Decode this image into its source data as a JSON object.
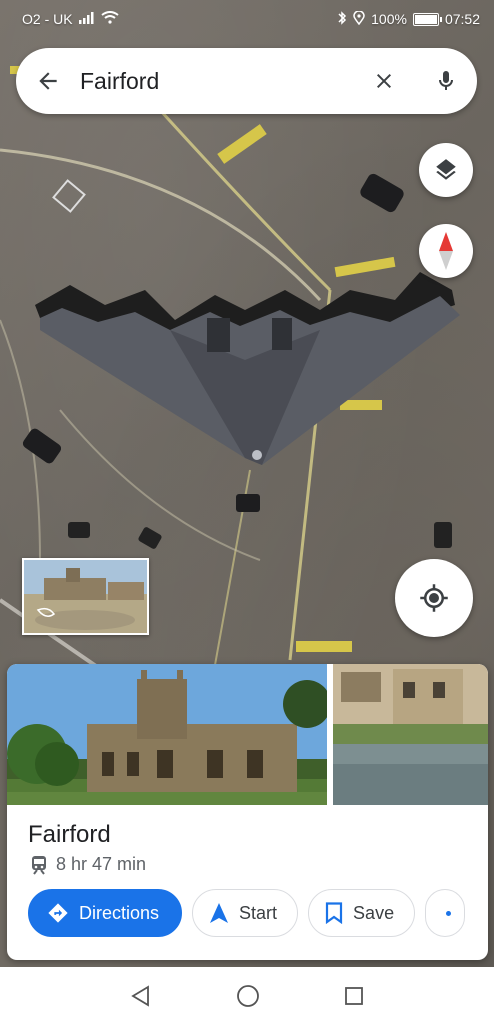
{
  "status_bar": {
    "carrier": "O2 - UK",
    "battery": "100%",
    "time": "07:52"
  },
  "search": {
    "query": "Fairford"
  },
  "place": {
    "name": "Fairford",
    "travel_mode_icon": "train-icon",
    "travel_time": "8 hr 47 min"
  },
  "actions": {
    "directions": "Directions",
    "start": "Start",
    "save": "Save"
  },
  "colors": {
    "accent": "#1a73e8",
    "compass_red": "#e53935"
  }
}
